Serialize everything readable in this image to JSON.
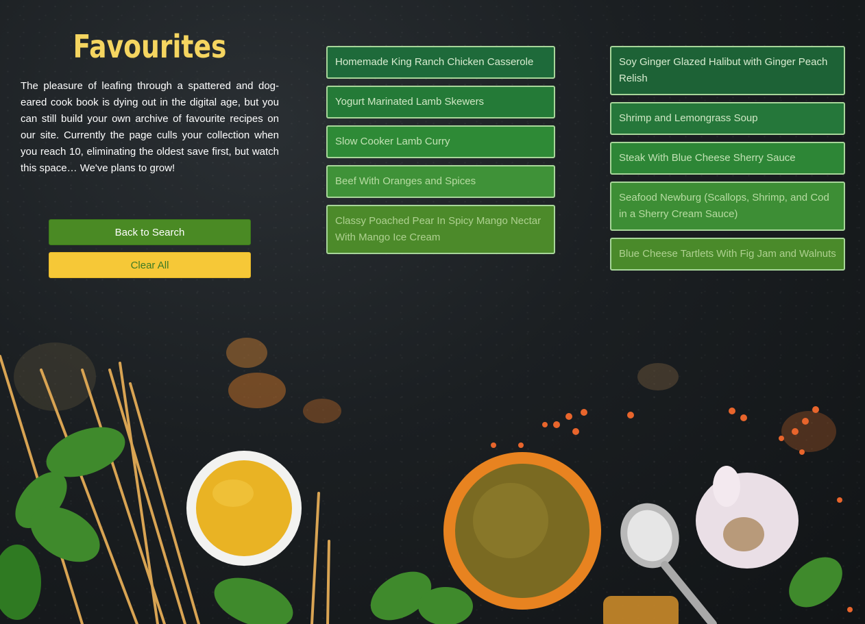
{
  "page": {
    "title": "Favourites",
    "intro": "The pleasure of leafing through a spattered and dog-eared cook book is dying out in the digital age, but you can still build your own archive of favourite recipes on our site. Currently the page culls your collection when you reach 10, eliminating the oldest save first, but watch this space… We've plans to grow!"
  },
  "buttons": {
    "back_label": "Back to Search",
    "clear_label": "Clear All"
  },
  "favourites": {
    "column_a": [
      {
        "title": "Homemade King Ranch Chicken Casserole",
        "bg": "#1e6a3a",
        "fg": "#d8ecd0"
      },
      {
        "title": "Yogurt Marinated Lamb Skewers",
        "bg": "#247a37",
        "fg": "#cfe7c4"
      },
      {
        "title": "Slow Cooker Lamb Curry",
        "bg": "#2e8a36",
        "fg": "#c2e2b4"
      },
      {
        "title": "Beef With Oranges and Spices",
        "bg": "#3f9238",
        "fg": "#b7dca2"
      },
      {
        "title": "Classy Poached Pear In Spicy Mango Nectar With Mango Ice Cream",
        "bg": "#4c8a2a",
        "fg": "#aed190"
      }
    ],
    "column_b": [
      {
        "title": "Soy Ginger Glazed Halibut with Ginger Peach Relish",
        "bg": "#1d6236",
        "fg": "#d8ecd0"
      },
      {
        "title": "Shrimp and Lemongrass Soup",
        "bg": "#25773a",
        "fg": "#cfe7c4"
      },
      {
        "title": "Steak With Blue Cheese Sherry Sauce",
        "bg": "#2d8636",
        "fg": "#c2e2b4"
      },
      {
        "title": "Seafood Newburg (Scallops, Shrimp, and Cod in a Sherry Cream Sauce)",
        "bg": "#3d8e35",
        "fg": "#b7dca2"
      },
      {
        "title": "Blue Cheese Tartlets With Fig Jam and Walnuts",
        "bg": "#4a8a2a",
        "fg": "#aed190"
      }
    ]
  },
  "colors": {
    "title": "#f5d560",
    "back_button": "#4a8a24",
    "clear_button": "#f6c837",
    "card_border": "#a8d69a"
  }
}
